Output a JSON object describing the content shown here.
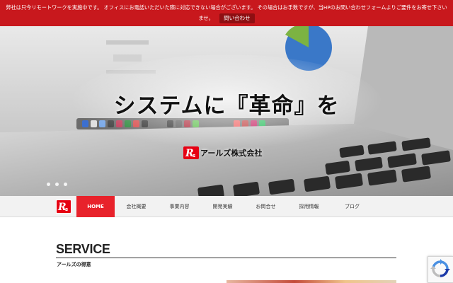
{
  "notice": {
    "message": "弊社は只今リモートワークを実施中です。 オフィスにお電話いただいた際に対応できない場合がございます。 その場合はお手数ですが、当HPのお問い合わせフォームよりご要件をお寄せ下さいませ。",
    "button_label": "問い合わせ"
  },
  "hero": {
    "headline": "システムに『革命』を",
    "company_name": "アールズ株式会社",
    "slide_count": 3
  },
  "nav": {
    "items": [
      {
        "label": "HOME",
        "active": true
      },
      {
        "label": "会社概要"
      },
      {
        "label": "事業内容"
      },
      {
        "label": "開発実績"
      },
      {
        "label": "お問合せ"
      },
      {
        "label": "採用情報"
      },
      {
        "label": "ブログ"
      }
    ]
  },
  "service": {
    "title": "SERVICE",
    "subtitle": "アールズの得意"
  },
  "icons": {
    "brand_logo": "rs-logo-icon",
    "recaptcha": "recaptcha-icon"
  },
  "colors": {
    "notice_bg": "#c8181d",
    "nav_active": "#e8222b",
    "brand_red": "#e60012"
  }
}
